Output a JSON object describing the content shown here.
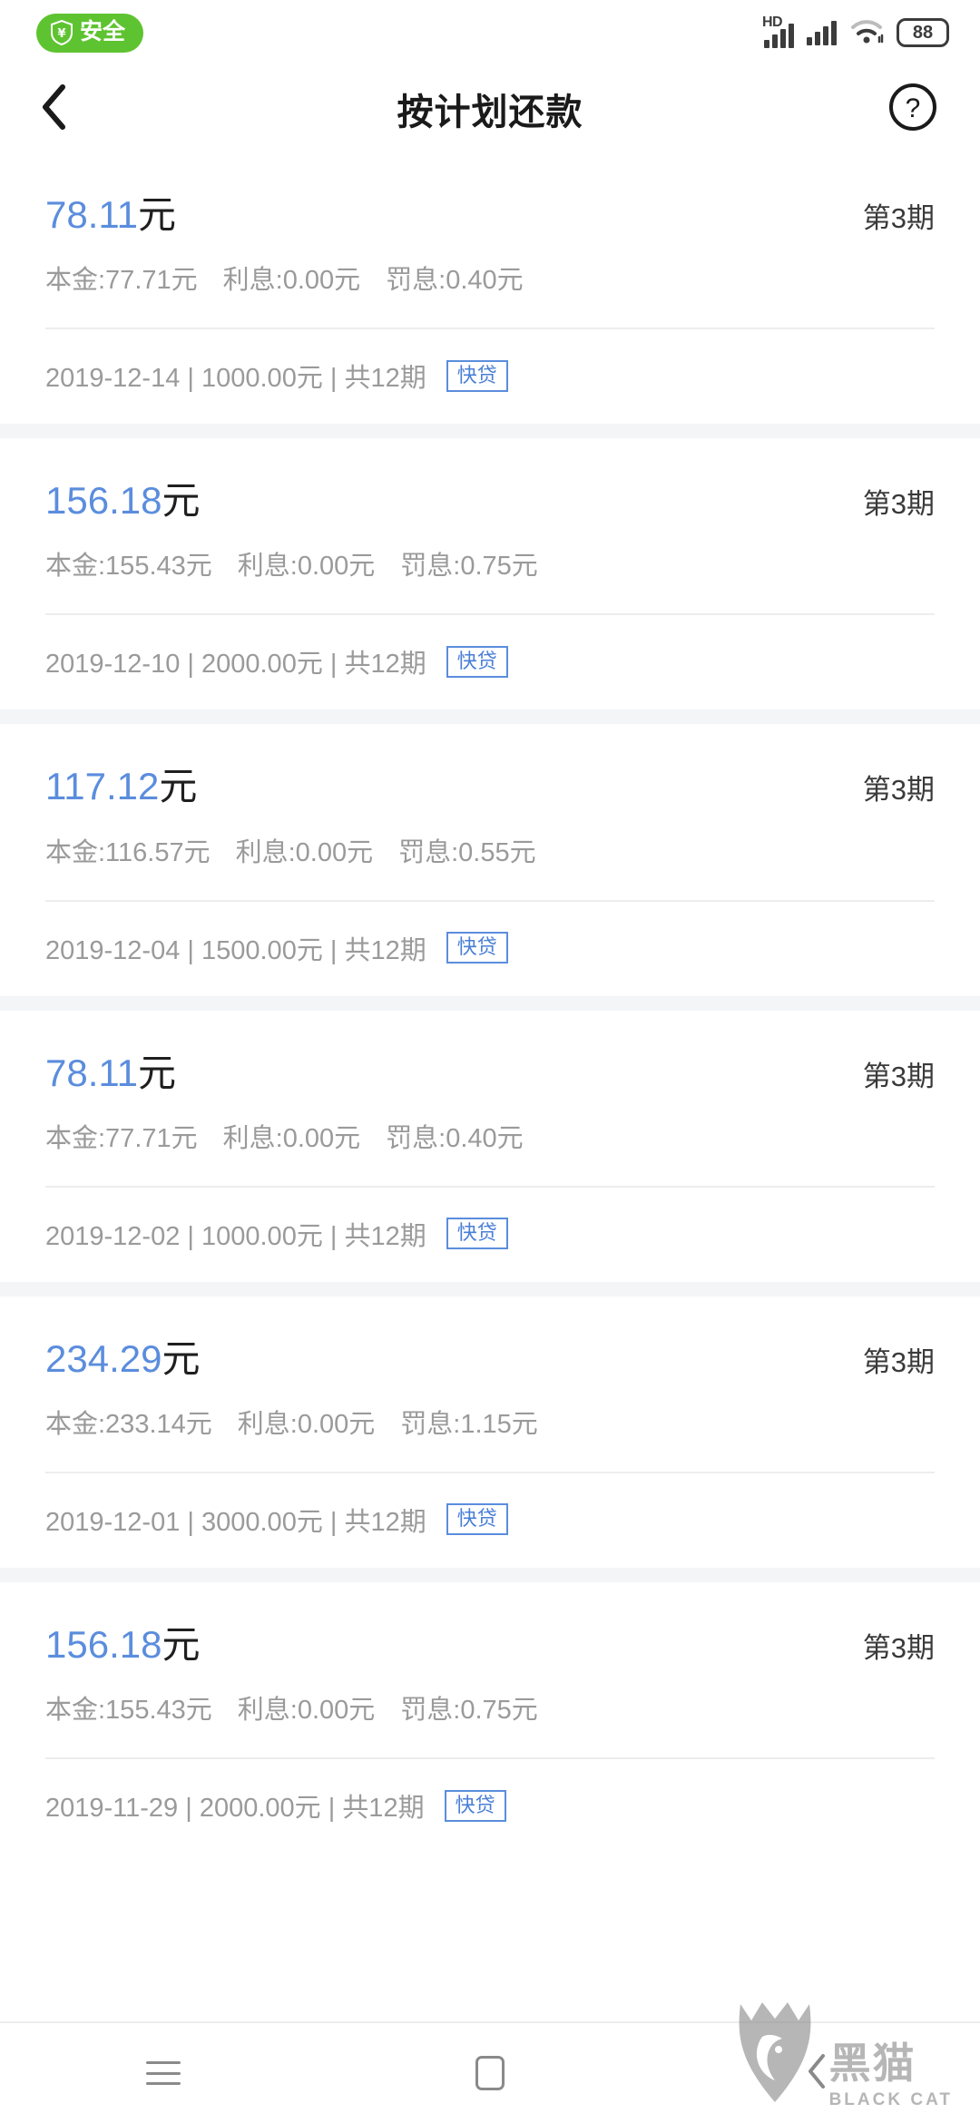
{
  "status_bar": {
    "safe_badge_label": "安全",
    "safe_badge_icon": "shield-yuan-icon",
    "network_label": "HD",
    "signal_icon": "signal-bars-icon",
    "wifi_icon": "wifi-icon",
    "battery_level": "88"
  },
  "header": {
    "back_icon": "chevron-left-icon",
    "title": "按计划还款",
    "help_icon": "question-circle-icon"
  },
  "labels": {
    "principal_prefix": "本金:",
    "interest_prefix": "利息:",
    "penalty_prefix": "罚息:",
    "separator": " | "
  },
  "repayment_plans": [
    {
      "amount_number": "78.11",
      "amount_unit": "元",
      "period": "第3期",
      "principal": "本金:77.71元",
      "interest": "利息:0.00元",
      "penalty": "罚息:0.40元",
      "meta": "2019-12-14 | 1000.00元 | 共12期",
      "tag": "快贷"
    },
    {
      "amount_number": "156.18",
      "amount_unit": "元",
      "period": "第3期",
      "principal": "本金:155.43元",
      "interest": "利息:0.00元",
      "penalty": "罚息:0.75元",
      "meta": "2019-12-10 | 2000.00元 | 共12期",
      "tag": "快贷"
    },
    {
      "amount_number": "117.12",
      "amount_unit": "元",
      "period": "第3期",
      "principal": "本金:116.57元",
      "interest": "利息:0.00元",
      "penalty": "罚息:0.55元",
      "meta": "2019-12-04 | 1500.00元 | 共12期",
      "tag": "快贷"
    },
    {
      "amount_number": "78.11",
      "amount_unit": "元",
      "period": "第3期",
      "principal": "本金:77.71元",
      "interest": "利息:0.00元",
      "penalty": "罚息:0.40元",
      "meta": "2019-12-02 | 1000.00元 | 共12期",
      "tag": "快贷"
    },
    {
      "amount_number": "234.29",
      "amount_unit": "元",
      "period": "第3期",
      "principal": "本金:233.14元",
      "interest": "利息:0.00元",
      "penalty": "罚息:1.15元",
      "meta": "2019-12-01 | 3000.00元 | 共12期",
      "tag": "快贷"
    },
    {
      "amount_number": "156.18",
      "amount_unit": "元",
      "period": "第3期",
      "principal": "本金:155.43元",
      "interest": "利息:0.00元",
      "penalty": "罚息:0.75元",
      "meta": "2019-11-29 | 2000.00元 | 共12期",
      "tag": "快贷"
    }
  ],
  "nav_bar": {
    "recents_icon": "hamburger-menu-icon",
    "home_icon": "home-square-icon",
    "back_icon": "chevron-left-icon"
  },
  "watermark": {
    "cat_icon": "black-cat-logo-icon",
    "cn_text": "黑猫",
    "en_text": "BLACK CAT"
  },
  "colors": {
    "accent_blue": "#5b8ddd",
    "safe_green": "#5ec330",
    "muted_gray": "#9a9a9a",
    "page_bg": "#f4f5f7"
  }
}
